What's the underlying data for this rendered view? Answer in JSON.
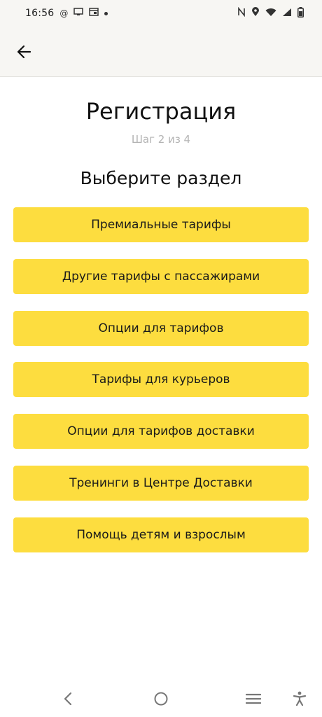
{
  "status_bar": {
    "time": "16:56",
    "left_icons": [
      "at-sign-icon",
      "monitor-icon",
      "calendar-icon",
      "dot-icon"
    ],
    "right_icons": [
      "nfc-icon",
      "location-icon",
      "wifi-icon",
      "signal-icon",
      "battery-icon"
    ]
  },
  "header": {
    "back_icon": "arrow-left-icon"
  },
  "page": {
    "title": "Регистрация",
    "step": "Шаг 2 из 4",
    "section_title": "Выберите раздел"
  },
  "options": [
    {
      "label": "Премиальные тарифы"
    },
    {
      "label": "Другие тарифы с пассажирами"
    },
    {
      "label": "Опции для тарифов"
    },
    {
      "label": "Тарифы для курьеров"
    },
    {
      "label": "Опции для тарифов доставки"
    },
    {
      "label": "Тренинги в Центре Доставки"
    },
    {
      "label": "Помощь детям и взрослым"
    }
  ],
  "nav_bar": {
    "icons": [
      "nav-back-icon",
      "nav-home-icon",
      "nav-recents-icon",
      "accessibility-icon"
    ]
  },
  "colors": {
    "button_bg": "#fddd3f",
    "bar_bg": "#f7f6f3",
    "subtitle": "#b3b3b3"
  }
}
